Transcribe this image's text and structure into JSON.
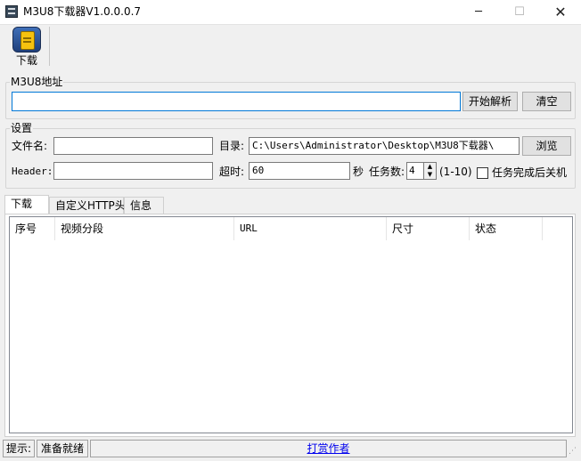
{
  "window": {
    "title": "M3U8下载器V1.0.0.0.7",
    "min": "─",
    "max": "☐",
    "close": "✕"
  },
  "toolbar": {
    "download_label": "下载"
  },
  "url_group": {
    "label": "M3U8地址",
    "url_value": "",
    "parse_label": "开始解析",
    "clear_label": "清空"
  },
  "settings": {
    "label": "设置",
    "filename_label": "文件名:",
    "filename_value": "",
    "dir_label": "目录:",
    "dir_value": "C:\\Users\\Administrator\\Desktop\\M3U8下载器\\",
    "browse_label": "浏览",
    "header_label": "Header:",
    "header_value": "",
    "timeout_label": "超时:",
    "timeout_value": "60",
    "seconds_label": "秒",
    "tasks_label": "任务数:",
    "tasks_value": "4",
    "tasks_range": "(1-10)",
    "shutdown_label": "任务完成后关机",
    "shutdown_checked": false
  },
  "tabs": [
    {
      "label": "下载",
      "active": true
    },
    {
      "label": "自定义HTTP头",
      "active": false
    },
    {
      "label": "信息",
      "active": false
    }
  ],
  "table": {
    "columns": [
      "序号",
      "视频分段",
      "URL",
      "尺寸",
      "状态"
    ],
    "rows": []
  },
  "status": {
    "hint_label": "提示:",
    "state": "准备就绪",
    "donate_link": "打赏作者"
  }
}
